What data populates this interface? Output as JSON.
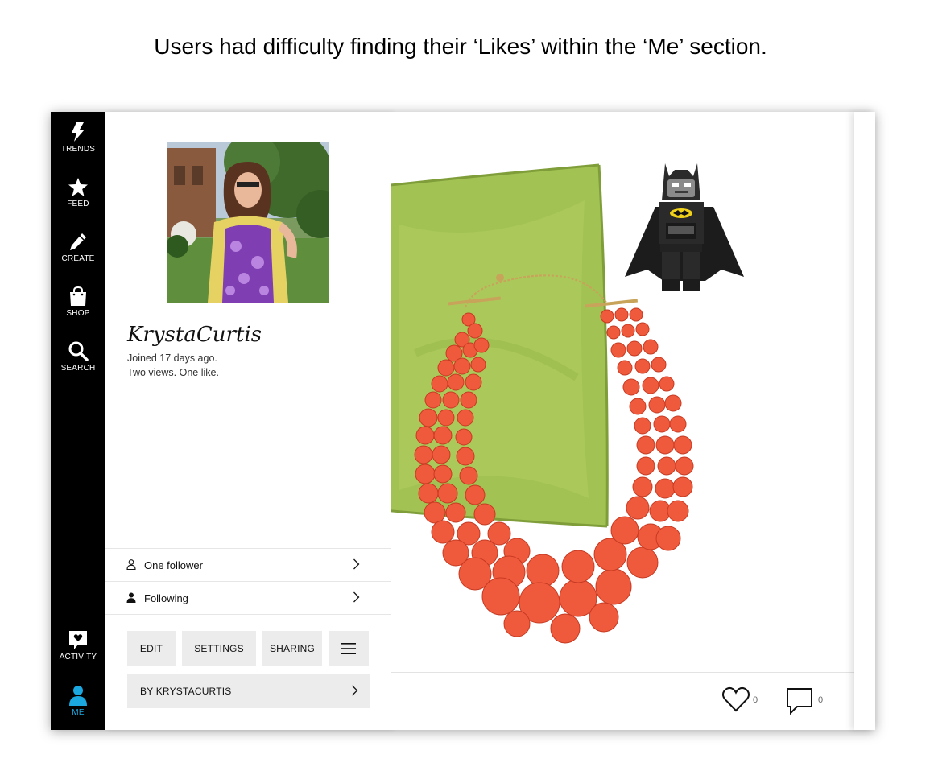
{
  "caption": "Users had difficulty finding their ‘Likes’ within the ‘Me’ section.",
  "nav": {
    "items": [
      {
        "label": "TRENDS",
        "icon": "lightning-icon"
      },
      {
        "label": "FEED",
        "icon": "star-icon"
      },
      {
        "label": "CREATE",
        "icon": "pencil-icon"
      },
      {
        "label": "SHOP",
        "icon": "shopping-bag-icon"
      },
      {
        "label": "SEARCH",
        "icon": "search-icon"
      },
      {
        "label": "ACTIVITY",
        "icon": "heart-speech-bubble-icon"
      },
      {
        "label": "ME",
        "icon": "person-icon"
      }
    ],
    "active": "ME",
    "active_color": "#1ba8e0"
  },
  "profile": {
    "username": "KrystaCurtis",
    "joined": "Joined 17 days ago.",
    "stats": "Two views. One like.",
    "followers_label": "One follower",
    "following_label": "Following",
    "buttons": {
      "edit": "EDIT",
      "settings": "SETTINGS",
      "sharing": "SHARING"
    },
    "menu_icon": "hamburger-menu-icon",
    "byline": "BY KRYSTACURTIS"
  },
  "post": {
    "likes": "0",
    "comments": "0",
    "items": [
      "green-velvet-pillow",
      "coral-beaded-necklace",
      "lego-batman-figure"
    ]
  }
}
